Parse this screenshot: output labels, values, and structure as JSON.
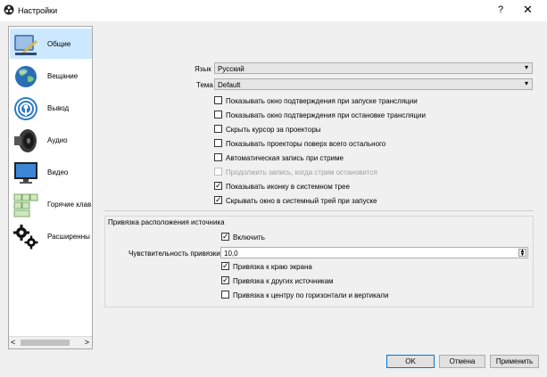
{
  "window": {
    "title": "Настройки",
    "help": "?",
    "close": "✕"
  },
  "sidebar": {
    "items": [
      {
        "label": "Общие",
        "icon": "general-settings-icon"
      },
      {
        "label": "Вещание",
        "icon": "globe-icon"
      },
      {
        "label": "Вывод",
        "icon": "output-broadcast-icon"
      },
      {
        "label": "Аудио",
        "icon": "speaker-icon"
      },
      {
        "label": "Видео",
        "icon": "monitor-icon"
      },
      {
        "label": "Горячие клав",
        "icon": "keyboard-icon"
      },
      {
        "label": "Расширенны",
        "icon": "gears-icon"
      }
    ],
    "scroll_left": "<",
    "scroll_right": ">"
  },
  "general": {
    "language_label": "Язык",
    "language_value": "Русский",
    "theme_label": "Тема",
    "theme_value": "Default",
    "checkboxes": [
      {
        "label": "Показывать окно подтверждения при запуске трансляции",
        "checked": false,
        "disabled": false
      },
      {
        "label": "Показывать окно подтверждения при остановке трансляции",
        "checked": false,
        "disabled": false
      },
      {
        "label": "Скрыть курсор за проекторы",
        "checked": false,
        "disabled": false
      },
      {
        "label": "Показывать проекторы поверх всего остального",
        "checked": false,
        "disabled": false
      },
      {
        "label": "Автоматическая запись при стриме",
        "checked": false,
        "disabled": false
      },
      {
        "label": "Продолжить запись, когда стрим остановится",
        "checked": false,
        "disabled": true
      },
      {
        "label": "Показывать иконку в системном трее",
        "checked": true,
        "disabled": false
      },
      {
        "label": "Скрывать окно в системный трей при запуске",
        "checked": true,
        "disabled": false
      }
    ]
  },
  "snapping": {
    "group_title": "Привязка расположения источника",
    "enable_label": "Включить",
    "enable_checked": true,
    "sensitivity_label": "Чувствительность привязки",
    "sensitivity_value": "10,0",
    "checkboxes": [
      {
        "label": "Привязка к краю экрана",
        "checked": true
      },
      {
        "label": "Привязка к других источникам",
        "checked": true
      },
      {
        "label": "Привязка к центру по горизонтали и вертикали",
        "checked": false
      }
    ]
  },
  "buttons": {
    "ok": "OK",
    "cancel": "Отмена",
    "apply": "Применить"
  },
  "colors": {
    "selected": "#cce8ff",
    "default_button_border": "#0078d7"
  }
}
